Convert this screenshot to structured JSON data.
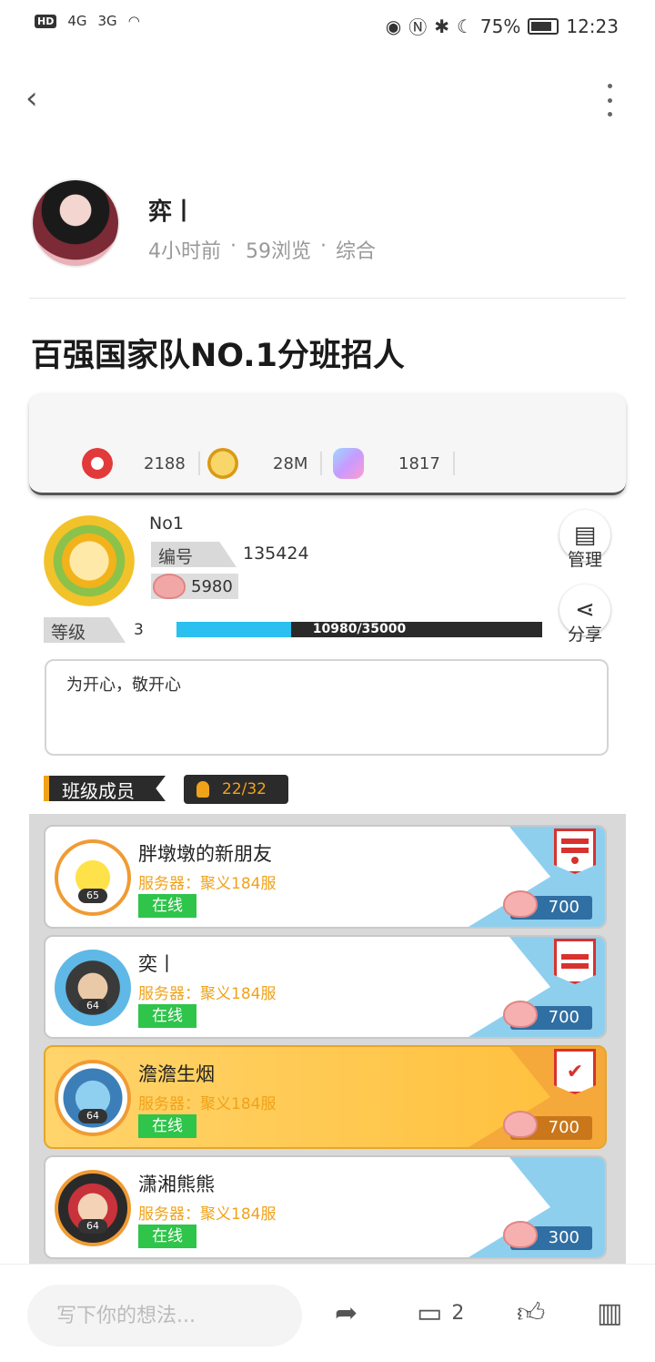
{
  "status_bar": {
    "left": [
      "HD",
      "4G",
      "3G"
    ],
    "battery": "75%",
    "time": "12:23"
  },
  "nav": {
    "back_icon": "chevron-left-icon",
    "more_icon": "more-vertical-icon"
  },
  "post": {
    "author": "弈丨",
    "time_ago": "4小时前",
    "views": "59浏览",
    "category": "综合",
    "title": "百强国家队NO.1分班招人"
  },
  "game": {
    "currencies": [
      {
        "icon": "red-gem-icon",
        "value": "2188"
      },
      {
        "icon": "gold-coin-icon",
        "value": "28M"
      },
      {
        "icon": "crystal-icon",
        "value": "1817"
      }
    ],
    "guild": {
      "name": "No1",
      "id_label": "编号",
      "id_value": "135424",
      "piggy_value": "5980",
      "level_label": "等级",
      "level_value": "3",
      "progress_text": "10980/35000",
      "progress": 0.3137,
      "manage_label": "管理",
      "share_label": "分享",
      "motto": "为开心，敬开心"
    },
    "members_header": "班级成员",
    "members_count": "22/32",
    "members": [
      {
        "name": "胖墩墩的新朋友",
        "level": "65",
        "server": "服务器：聚义184服",
        "status": "在线",
        "score": "700"
      },
      {
        "name": "奕丨",
        "level": "64",
        "server": "服务器：聚义184服",
        "status": "在线",
        "score": "700"
      },
      {
        "name": "澹澹生烟",
        "level": "64",
        "server": "服务器：聚义184服",
        "status": "在线",
        "score": "700"
      },
      {
        "name": "潇湘熊熊",
        "level": "64",
        "server": "服务器：聚义184服",
        "status": "在线",
        "score": "300"
      }
    ]
  },
  "bottom": {
    "comment_placeholder": "写下你的想法...",
    "comment_count": "2"
  }
}
